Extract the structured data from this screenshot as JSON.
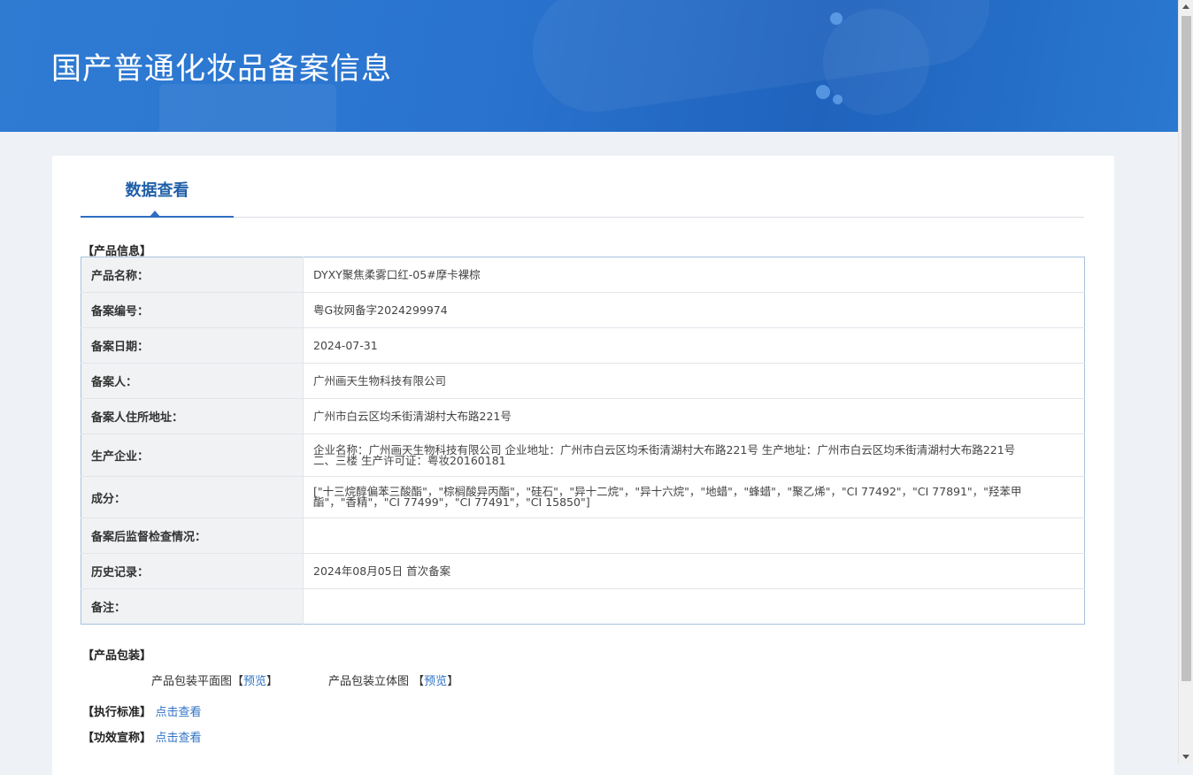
{
  "banner": {
    "title": "国产普通化妆品备案信息"
  },
  "tabs": [
    {
      "label": "数据查看"
    }
  ],
  "product_info": {
    "section_title": "【产品信息】",
    "rows": [
      {
        "label": "产品名称：",
        "value": "DYXY聚焦柔雾口红-05#摩卡裸棕"
      },
      {
        "label": "备案编号：",
        "value": "粤G妆网备字2024299974"
      },
      {
        "label": "备案日期：",
        "value": "2024-07-31"
      },
      {
        "label": "备案人：",
        "value": "广州画天生物科技有限公司"
      },
      {
        "label": "备案人住所地址：",
        "value": "广州市白云区均禾街清湖村大布路221号"
      },
      {
        "label": "生产企业：",
        "value": "企业名称：广州画天生物科技有限公司 企业地址：广州市白云区均禾街清湖村大布路221号 生产地址：广州市白云区均禾街清湖村大布路221号二、三楼 生产许可证：粤妆20160181"
      },
      {
        "label": "成分：",
        "value": "[\"十三烷醇偏苯三酸酯\"，\"棕榈酸异丙酯\"，\"硅石\"，\"异十二烷\"，\"异十六烷\"，\"地蜡\"，\"蜂蜡\"，\"聚乙烯\"，\"CI 77492\"，\"CI 77891\"，\"羟苯甲酯\"，\"香精\"，\"CI 77499\"，\"CI 77491\"，\"CI 15850\"]"
      },
      {
        "label": "备案后监督检查情况：",
        "value": ""
      },
      {
        "label": "历史记录：",
        "value": "2024年08月05日 首次备案"
      },
      {
        "label": "备注：",
        "value": ""
      }
    ]
  },
  "packaging": {
    "section_title": "【产品包装】",
    "flat_label": "产品包装平面图",
    "flat_link": "预览",
    "solid_label": "产品包装立体图",
    "solid_link": "预览",
    "bracket_open": "【",
    "bracket_close": "】"
  },
  "standard": {
    "label": "【执行标准】",
    "link": "点击查看"
  },
  "efficacy": {
    "label": "【功效宣称】",
    "link": "点击查看"
  }
}
